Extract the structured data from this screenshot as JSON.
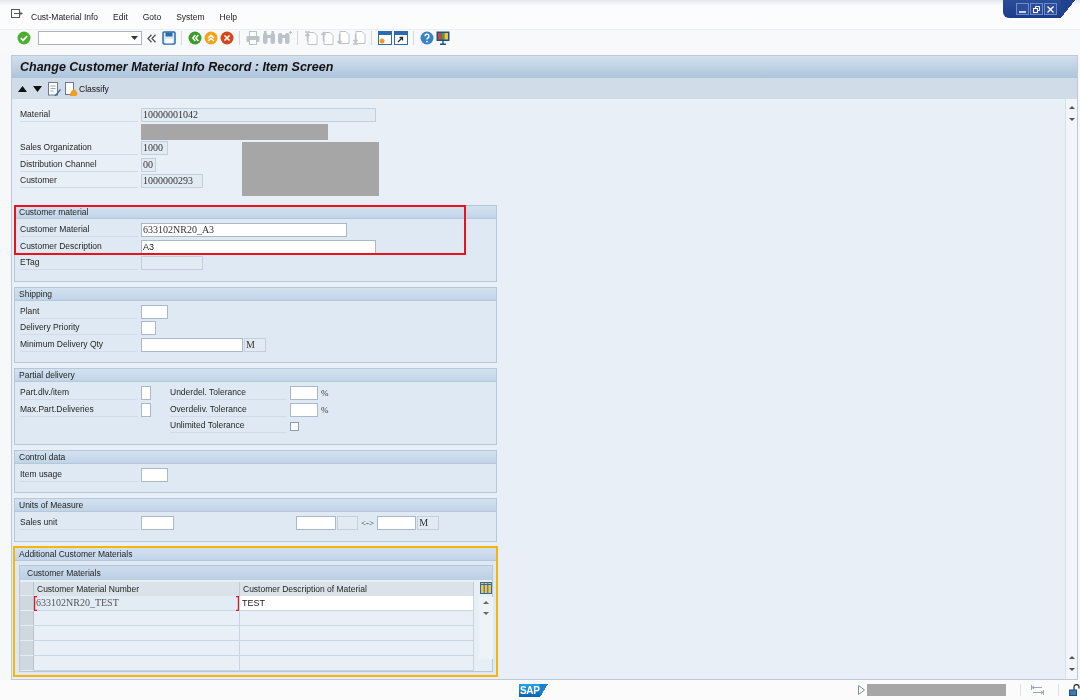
{
  "menu_bar": {
    "items": [
      {
        "label": "Cust-Material Info"
      },
      {
        "label": "Edit"
      },
      {
        "label": "Goto"
      },
      {
        "label": "System"
      },
      {
        "label": "Help"
      }
    ]
  },
  "toolbar": {
    "buttons": [
      {
        "kind": "enter",
        "disabled": false
      },
      {
        "kind": "command-field"
      },
      {
        "kind": "collapse",
        "disabled": false
      },
      {
        "kind": "save",
        "disabled": false
      },
      {
        "kind": "separator"
      },
      {
        "kind": "back",
        "disabled": false
      },
      {
        "kind": "exit",
        "disabled": false
      },
      {
        "kind": "cancel",
        "disabled": false
      },
      {
        "kind": "separator"
      },
      {
        "kind": "print",
        "disabled": true
      },
      {
        "kind": "find",
        "disabled": true
      },
      {
        "kind": "find-next",
        "disabled": true
      },
      {
        "kind": "separator"
      },
      {
        "kind": "first-page",
        "disabled": true
      },
      {
        "kind": "previous-page",
        "disabled": true
      },
      {
        "kind": "next-page",
        "disabled": true
      },
      {
        "kind": "last-page",
        "disabled": true
      },
      {
        "kind": "separator"
      },
      {
        "kind": "new-session",
        "disabled": false
      },
      {
        "kind": "shortcut",
        "disabled": false
      },
      {
        "kind": "separator"
      },
      {
        "kind": "help",
        "disabled": false
      },
      {
        "kind": "layout",
        "disabled": false
      }
    ]
  },
  "screen_title": "Change Customer Material Info Record : Item Screen",
  "app_toolbar": {
    "items": [
      {
        "kind": "previous"
      },
      {
        "kind": "next"
      },
      {
        "kind": "edit"
      },
      {
        "kind": "classify",
        "label": "Classify"
      }
    ]
  },
  "header": {
    "fields": [
      {
        "label": "Material",
        "kind": "code",
        "value": "10000001042",
        "editable": false
      },
      {
        "label": "Sales Organization",
        "kind": "code",
        "value": "1000",
        "editable": false
      },
      {
        "label": "Distribution Channel",
        "kind": "code",
        "value": "00",
        "editable": false
      },
      {
        "label": "Customer",
        "kind": "code",
        "value": "1000000293",
        "editable": false
      }
    ]
  },
  "groups": [
    {
      "title": "Customer material",
      "frame": {
        "color": "#e8141c"
      },
      "columns": [
        [
          {
            "label": "Customer Material",
            "framed": true,
            "fields": [
              {
                "kind": "code",
                "value": "633102NR20_A3",
                "editable": true
              }
            ]
          },
          {
            "label": "Customer Description",
            "framed": true,
            "fields": [
              {
                "kind": "text",
                "value": "A3",
                "editable": true
              }
            ]
          },
          {
            "label": "ETag",
            "framed": false,
            "fields": [
              {
                "kind": "code",
                "editable": false
              }
            ]
          }
        ]
      ]
    },
    {
      "title": "Shipping",
      "columns": [
        [
          {
            "label": "Plant",
            "fields": [
              {
                "kind": "code",
                "editable": true
              }
            ]
          },
          {
            "label": "Delivery Priority",
            "fields": [
              {
                "kind": "code",
                "editable": true
              }
            ]
          },
          {
            "label": "Minimum Delivery Qty",
            "fields": [
              {
                "kind": "code",
                "editable": true
              },
              {
                "kind": "code",
                "value": "M",
                "editable": false
              }
            ]
          }
        ]
      ]
    },
    {
      "title": "Partial delivery",
      "columns": [
        [
          {
            "label": "Part.dlv./item",
            "fields": [
              {
                "kind": "code",
                "editable": true
              }
            ]
          },
          {
            "label": "Max.Part.Deliveries",
            "fields": [
              {
                "kind": "code",
                "editable": true
              }
            ]
          }
        ],
        [
          {
            "label": "Underdel. Tolerance",
            "fields": [
              {
                "kind": "code",
                "editable": true
              },
              {
                "kind": "sign",
                "value": "%"
              }
            ]
          },
          {
            "label": "Overdeliv. Tolerance",
            "fields": [
              {
                "kind": "code",
                "editable": true
              },
              {
                "kind": "sign",
                "value": "%"
              }
            ]
          },
          {
            "label": "Unlimited Tolerance",
            "fields": [
              {
                "kind": "checkbox",
                "checked": false
              }
            ]
          }
        ]
      ]
    },
    {
      "title": "Control data",
      "columns": [
        [
          {
            "label": "Item usage",
            "fields": [
              {
                "kind": "code",
                "editable": true
              }
            ]
          }
        ]
      ]
    },
    {
      "title": "Units of Measure",
      "columns": [
        [
          {
            "label": "Sales unit",
            "fields": [
              {
                "kind": "code",
                "editable": true
              },
              {
                "kind": "code",
                "editable": true
              },
              {
                "kind": "code",
                "editable": false
              },
              {
                "kind": "sign",
                "value": "<->"
              },
              {
                "kind": "code",
                "editable": true
              },
              {
                "kind": "code",
                "value": "M",
                "editable": false
              }
            ]
          }
        ]
      ]
    }
  ],
  "additional_customer_materials": {
    "title": "Additional Customer Materials",
    "frame": {
      "color": "#f5b50a"
    },
    "table": {
      "title": "Customer Materials",
      "columns": [
        "Customer Material Number",
        "Customer Description of Material"
      ],
      "rows": [
        {
          "selected": false,
          "cells": [
            {
              "value": "633102NR20_TEST",
              "editable": false,
              "marked": true
            },
            {
              "value": "TEST",
              "editable": true,
              "marked": false
            }
          ]
        }
      ]
    }
  },
  "status_bar": {
    "logo": "SAP"
  }
}
